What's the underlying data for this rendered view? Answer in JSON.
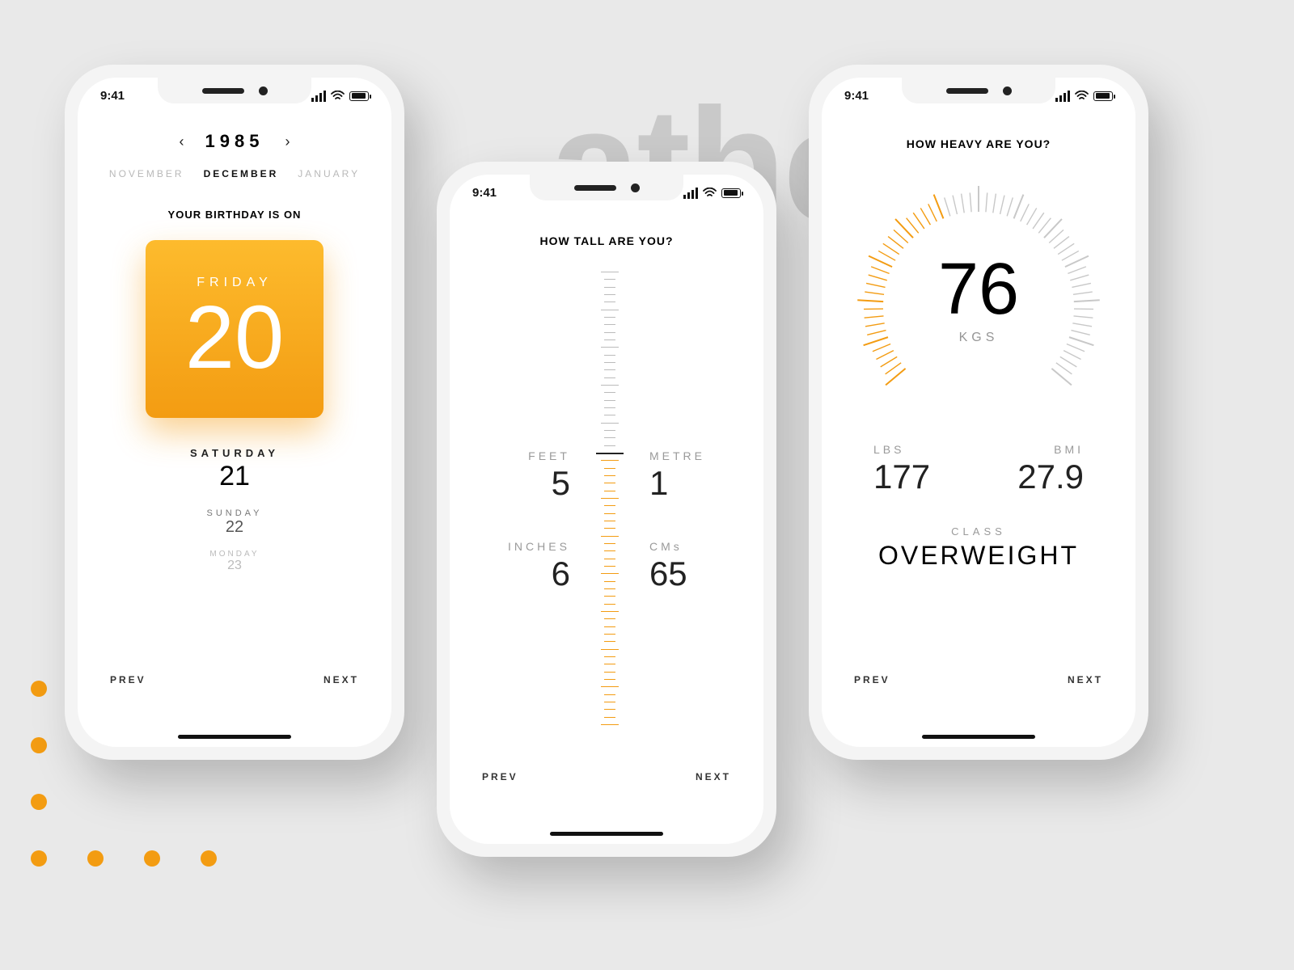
{
  "brand_bg_text": "athe",
  "accent": "#f39c12",
  "status": {
    "time": "9:41"
  },
  "nav": {
    "prev": "PREV",
    "next": "NEXT"
  },
  "screen1": {
    "year": "1985",
    "month_prev": "NOVEMBER",
    "month_current": "DECEMBER",
    "month_next": "JANUARY",
    "headline": "YOUR BIRTHDAY IS ON",
    "selected": {
      "dow": "FRIDAY",
      "day": "20"
    },
    "next_days": [
      {
        "dow": "SATURDAY",
        "day": "21"
      },
      {
        "dow": "SUNDAY",
        "day": "22"
      },
      {
        "dow": "MONDAY",
        "day": "23"
      }
    ]
  },
  "screen2": {
    "title": "HOW TALL ARE YOU?",
    "feet": {
      "label": "FEET",
      "value": "5"
    },
    "inches": {
      "label": "INCHES",
      "value": "6"
    },
    "metre": {
      "label": "METRE",
      "value": "1"
    },
    "cms": {
      "label": "CMs",
      "value": "65"
    }
  },
  "screen3": {
    "title": "HOW HEAVY ARE YOU?",
    "weight": {
      "value": "76",
      "unit": "KGS"
    },
    "lbs": {
      "label": "LBS",
      "value": "177"
    },
    "bmi": {
      "label": "BMI",
      "value": "27.9"
    },
    "class": {
      "label": "CLASS",
      "value": "OVERWEIGHT"
    },
    "gauge_fill_fraction": 0.42
  }
}
